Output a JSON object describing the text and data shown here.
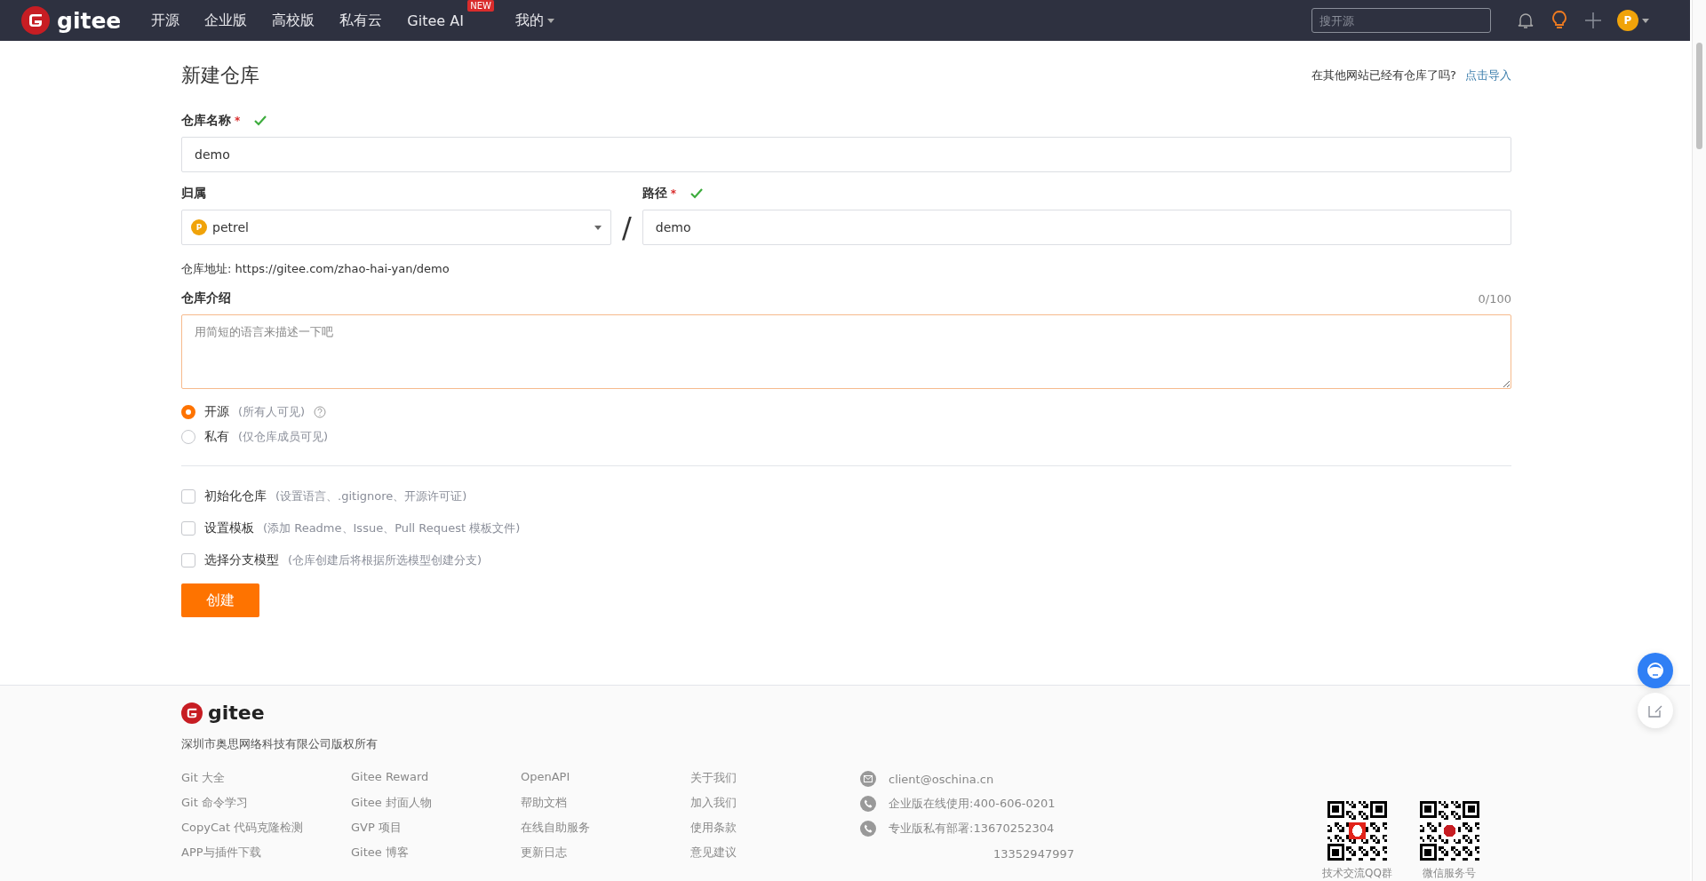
{
  "nav": {
    "logo": "gitee",
    "items": [
      {
        "label": "开源"
      },
      {
        "label": "企业版"
      },
      {
        "label": "高校版"
      },
      {
        "label": "私有云"
      },
      {
        "label": "Gitee AI",
        "badge": "NEW"
      }
    ],
    "mine": "我的",
    "search": {
      "placeholder": "搜开源"
    },
    "avatar": "P"
  },
  "header": {
    "title": "新建仓库",
    "import_prompt": "在其他网站已经有仓库了吗?",
    "import_link": "点击导入"
  },
  "name_field": {
    "label": "仓库名称",
    "required_mark": "*",
    "valid": true,
    "value": "demo"
  },
  "owner_field": {
    "label": "归属",
    "avatar": "P",
    "value": "petrel"
  },
  "separator": "/",
  "path_field": {
    "label": "路径",
    "required_mark": "*",
    "valid": true,
    "value": "demo"
  },
  "repo_address": {
    "label": "仓库地址:",
    "url": "https://gitee.com/zhao-hai-yan/demo"
  },
  "description": {
    "label": "仓库介绍",
    "counter": "0/100",
    "placeholder": "用简短的语言来描述一下吧"
  },
  "visibility": [
    {
      "label": "开源",
      "hint": "(所有人可见)",
      "selected": true,
      "help": true
    },
    {
      "label": "私有",
      "hint": "(仅仓库成员可见)",
      "selected": false,
      "help": false
    }
  ],
  "options": [
    {
      "label": "初始化仓库",
      "hint": "(设置语言、.gitignore、开源许可证)",
      "checked": false
    },
    {
      "label": "设置模板",
      "hint": "(添加 Readme、Issue、Pull Request 模板文件)",
      "checked": false
    },
    {
      "label": "选择分支模型",
      "hint": "(仓库创建后将根据所选模型创建分支)",
      "checked": false
    }
  ],
  "submit": "创建",
  "footer": {
    "logo": "gitee",
    "copyright": "深圳市奥思网络科技有限公司版权所有",
    "link_columns": [
      [
        "Git 大全",
        "Git 命令学习",
        "CopyCat 代码克隆检测",
        "APP与插件下载"
      ],
      [
        "Gitee Reward",
        "Gitee 封面人物",
        "GVP 项目",
        "Gitee 博客"
      ],
      [
        "OpenAPI",
        "帮助文档",
        "在线自助服务",
        "更新日志"
      ],
      [
        "关于我们",
        "加入我们",
        "使用条款",
        "意见建议"
      ]
    ],
    "contacts": [
      {
        "kind": "mail",
        "text": "client@oschina.cn"
      },
      {
        "kind": "phone",
        "text": "企业版在线使用:400-606-0201"
      },
      {
        "kind": "phone",
        "text": "专业版私有部署:13670252304"
      },
      {
        "kind": "plain",
        "text": "13352947997"
      }
    ],
    "qr_codes": [
      {
        "caption": "技术交流QQ群",
        "kind": "qq"
      },
      {
        "caption": "微信服务号",
        "kind": "gitee"
      }
    ]
  }
}
